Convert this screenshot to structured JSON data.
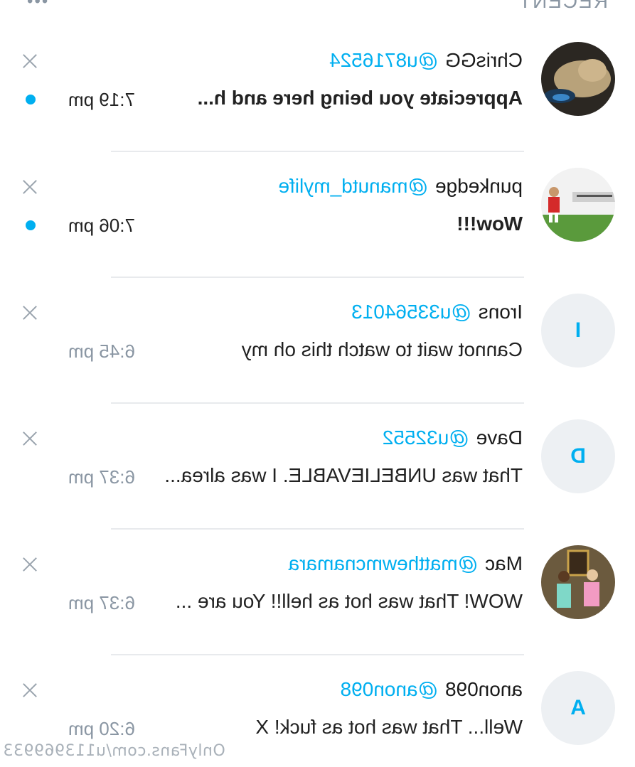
{
  "header": {
    "title": "RECENT",
    "more_icon": "more-dots-icon"
  },
  "colors": {
    "accent": "#00aff0",
    "muted": "#8a96a3",
    "divider": "#e8eaed"
  },
  "chats": [
    {
      "name": "ChrisGG",
      "username": "@u8716524",
      "message": "Appreciate you being here and h...",
      "time": "7:19 pm",
      "unread": true,
      "avatar": "photo-cat"
    },
    {
      "name": "punkedge",
      "username": "@manutd_mylife",
      "message": "Wow!!!",
      "time": "7:06 pm",
      "unread": true,
      "avatar": "photo-football"
    },
    {
      "name": "Irons",
      "username": "@u33564013",
      "message": "Cannot wait to watch this oh my",
      "time": "6:45 pm",
      "unread": false,
      "avatar_letter": "I"
    },
    {
      "name": "Dave",
      "username": "@u32552",
      "message": "That was UNBELIEVABLE. I was alrea...",
      "time": "6:37 pm",
      "unread": false,
      "avatar_letter": "D"
    },
    {
      "name": "Mac",
      "username": "@matthewmcnamara",
      "message": "WOW! That was hot as hell!! You are ...",
      "time": "6:37 pm",
      "unread": false,
      "avatar": "photo-couple"
    },
    {
      "name": "anon098",
      "username": "@anon098",
      "message": "Well... That was hot as fuck! X",
      "time": "6:20 pm",
      "unread": false,
      "avatar_letter": "A"
    }
  ],
  "watermark": "OnlyFans.com/u113969933"
}
